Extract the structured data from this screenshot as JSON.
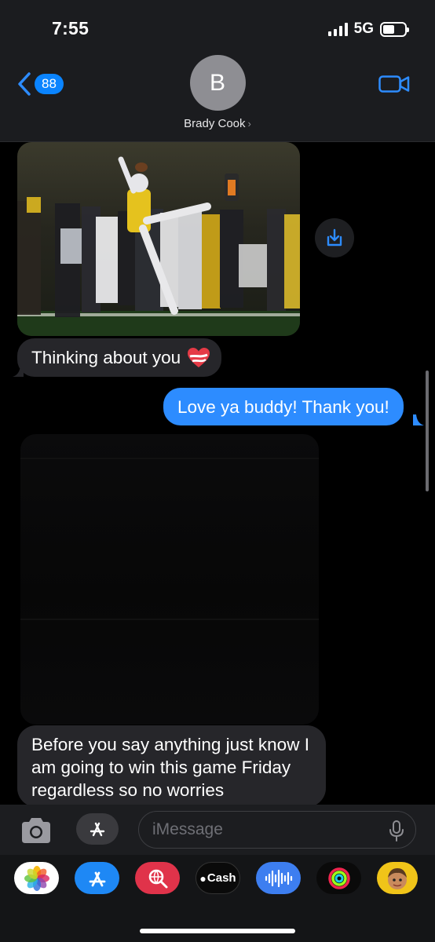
{
  "status_bar": {
    "time": "7:55",
    "network": "5G",
    "battery_level_percent": 55
  },
  "header": {
    "back_badge": "88",
    "contact_initial": "B",
    "contact_name": "Brady Cook",
    "icons": {
      "back": "chevron-left-icon",
      "video": "video-camera-icon"
    }
  },
  "messages": [
    {
      "type": "image",
      "direction": "incoming",
      "description_icon": "photo"
    },
    {
      "type": "text",
      "direction": "incoming",
      "text": "Thinking about you",
      "emoji": "heart-with-ribbon"
    },
    {
      "type": "text",
      "direction": "outgoing",
      "text": "Love ya buddy! Thank you!"
    },
    {
      "type": "image",
      "direction": "incoming",
      "obscured": true
    },
    {
      "type": "text",
      "direction": "incoming",
      "text": "Before you say anything just know I am going to win this game Friday regardless so no worries"
    }
  ],
  "composer": {
    "placeholder": "iMessage"
  },
  "app_drawer": {
    "cash_label": "Cash"
  },
  "colors": {
    "accent": "#2d8cff",
    "incoming_bubble": "#26262a",
    "background": "#000000"
  }
}
